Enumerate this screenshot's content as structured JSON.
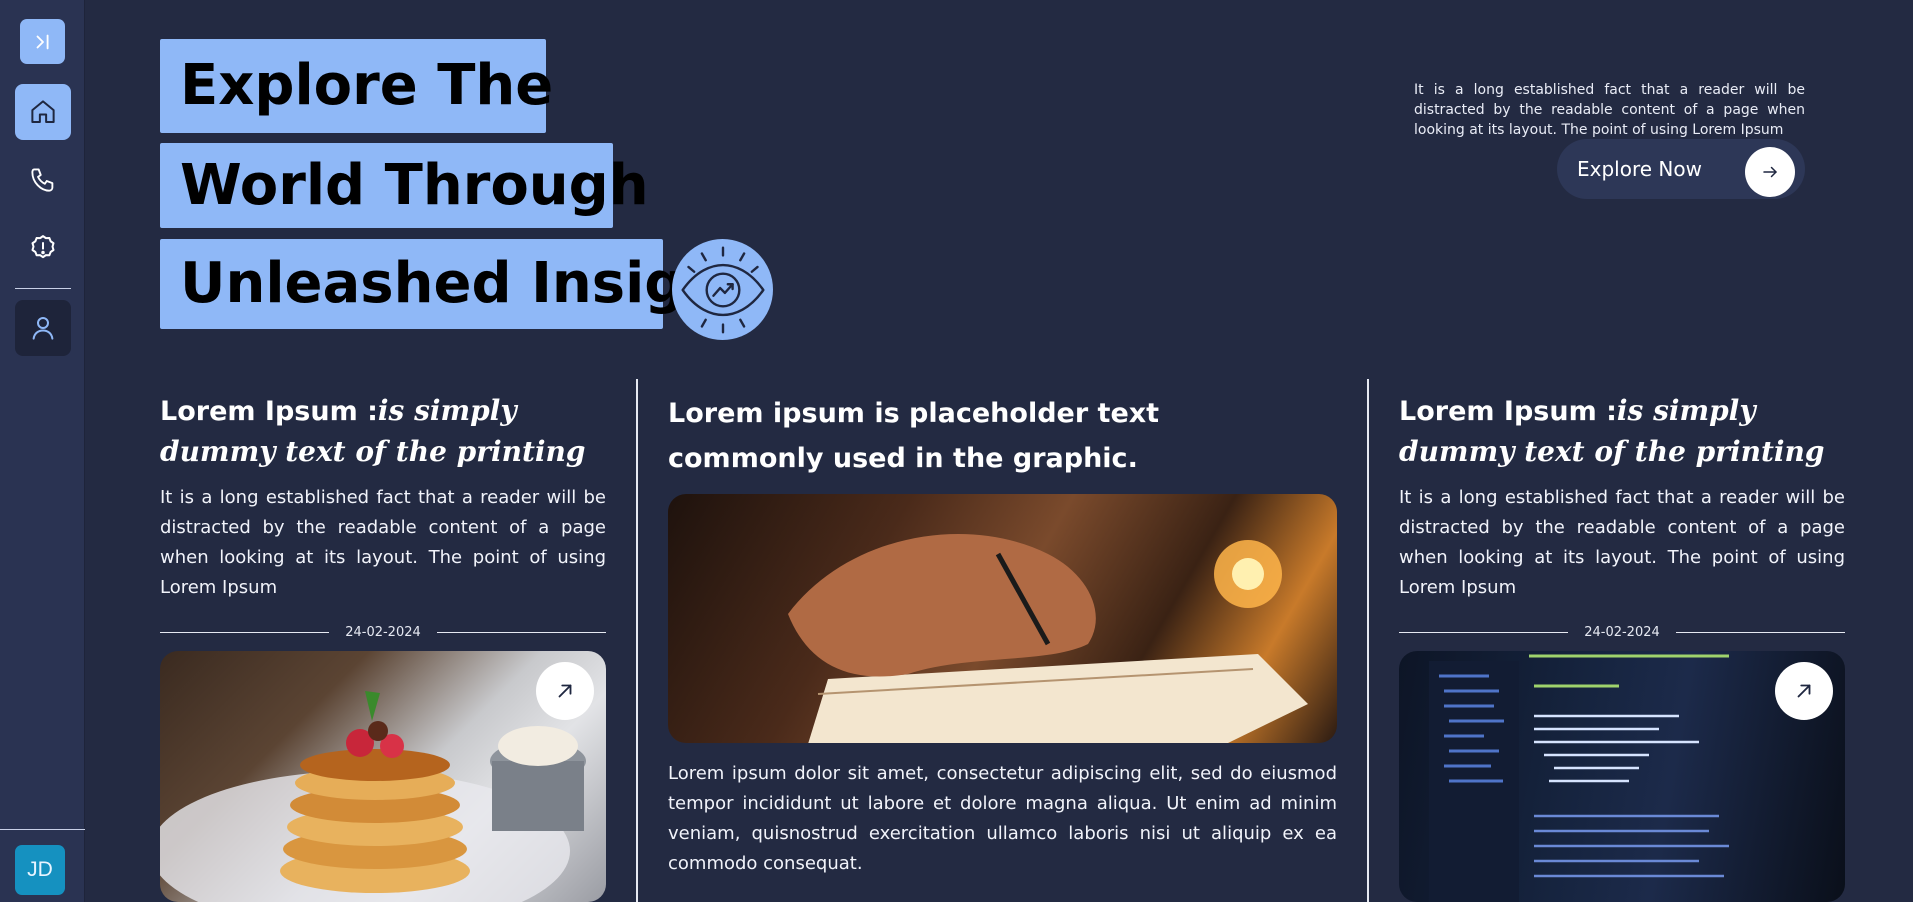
{
  "sidebar": {
    "toggle_icon": "collapse-right-icon",
    "items": [
      {
        "icon": "home-icon",
        "active": true
      },
      {
        "icon": "phone-icon",
        "active": false
      },
      {
        "icon": "info-icon",
        "active": false
      },
      {
        "icon": "user-icon",
        "active": false
      }
    ],
    "avatar_initials": "JD"
  },
  "hero": {
    "lines": [
      "Explore The",
      "World Through",
      "Unleashed Insight"
    ],
    "icon": "eye-trend-icon",
    "description": "It is a long established fact that a reader will be distracted by the readable content of a page when looking at its layout. The point of using Lorem Ipsum",
    "cta_label": "Explore Now"
  },
  "cards": [
    {
      "title_bold": "Lorem Ipsum :",
      "title_italic": "is simply dummy text of the printing",
      "text": "It is a long established fact that a reader will be distracted by the readable content of a page when looking at its layout. The point of using Lorem Ipsum",
      "date": "24-02-2024",
      "image": "pancakes-image"
    },
    {
      "title": "Lorem ipsum is placeholder text commonly used in the graphic.",
      "image": "writing-hand-image",
      "text": "Lorem ipsum dolor sit amet, consectetur adipiscing elit, sed do eiusmod tempor incididunt ut labore et dolore magna aliqua. Ut enim ad minim veniam, quisnostrud exercitation ullamco laboris nisi ut aliquip ex ea commodo consequat."
    },
    {
      "title_bold": "Lorem Ipsum :",
      "title_italic": "is simply dummy text of the printing",
      "text": "It is a long established fact that a reader will be distracted by the readable content of a page when looking at its layout. The point of using Lorem Ipsum",
      "date": "24-02-2024",
      "image": "code-screen-image"
    }
  ],
  "colors": {
    "background": "#232a42",
    "sidebar": "#2a3352",
    "accent": "#8fb8f7",
    "avatar": "#1591c0"
  }
}
